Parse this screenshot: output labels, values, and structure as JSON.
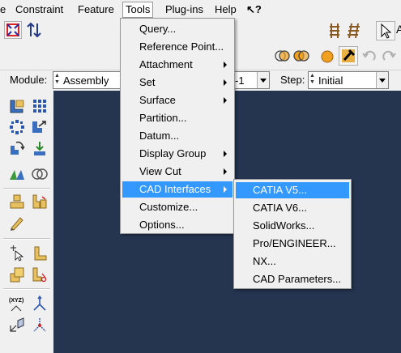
{
  "menubar": {
    "items": [
      {
        "label": "e"
      },
      {
        "label": "Constraint"
      },
      {
        "label": "Feature"
      },
      {
        "label": "Tools"
      },
      {
        "label": "Plug-ins"
      },
      {
        "label": "Help"
      },
      {
        "label": "↖?"
      }
    ]
  },
  "modulebar": {
    "module_label": "Module:",
    "module_value": "Assembly",
    "model_value": "-1",
    "step_label": "Step:",
    "step_value": "Initial"
  },
  "tools_menu": {
    "items": [
      {
        "label": "Query...",
        "submenu": false
      },
      {
        "label": "Reference Point...",
        "submenu": false
      },
      {
        "label": "Attachment",
        "submenu": true
      },
      {
        "label": "Set",
        "submenu": true
      },
      {
        "label": "Surface",
        "submenu": true
      },
      {
        "label": "Partition...",
        "submenu": false
      },
      {
        "label": "Datum...",
        "submenu": false
      },
      {
        "label": "Display Group",
        "submenu": true
      },
      {
        "label": "View Cut",
        "submenu": true
      },
      {
        "label": "CAD Interfaces",
        "submenu": true,
        "highlighted": true
      },
      {
        "label": "Customize...",
        "submenu": false
      },
      {
        "label": "Options...",
        "submenu": false
      }
    ]
  },
  "cad_menu": {
    "items": [
      {
        "label": "CATIA V5...",
        "highlighted": true
      },
      {
        "label": "CATIA V6..."
      },
      {
        "label": "SolidWorks..."
      },
      {
        "label": "Pro/ENGINEER..."
      },
      {
        "label": "NX..."
      },
      {
        "label": "CAD Parameters..."
      }
    ]
  },
  "toolbox": {
    "xyz_label": "(XYZ)"
  },
  "colors": {
    "viewport": "#253550",
    "highlight": "#3399ff"
  }
}
